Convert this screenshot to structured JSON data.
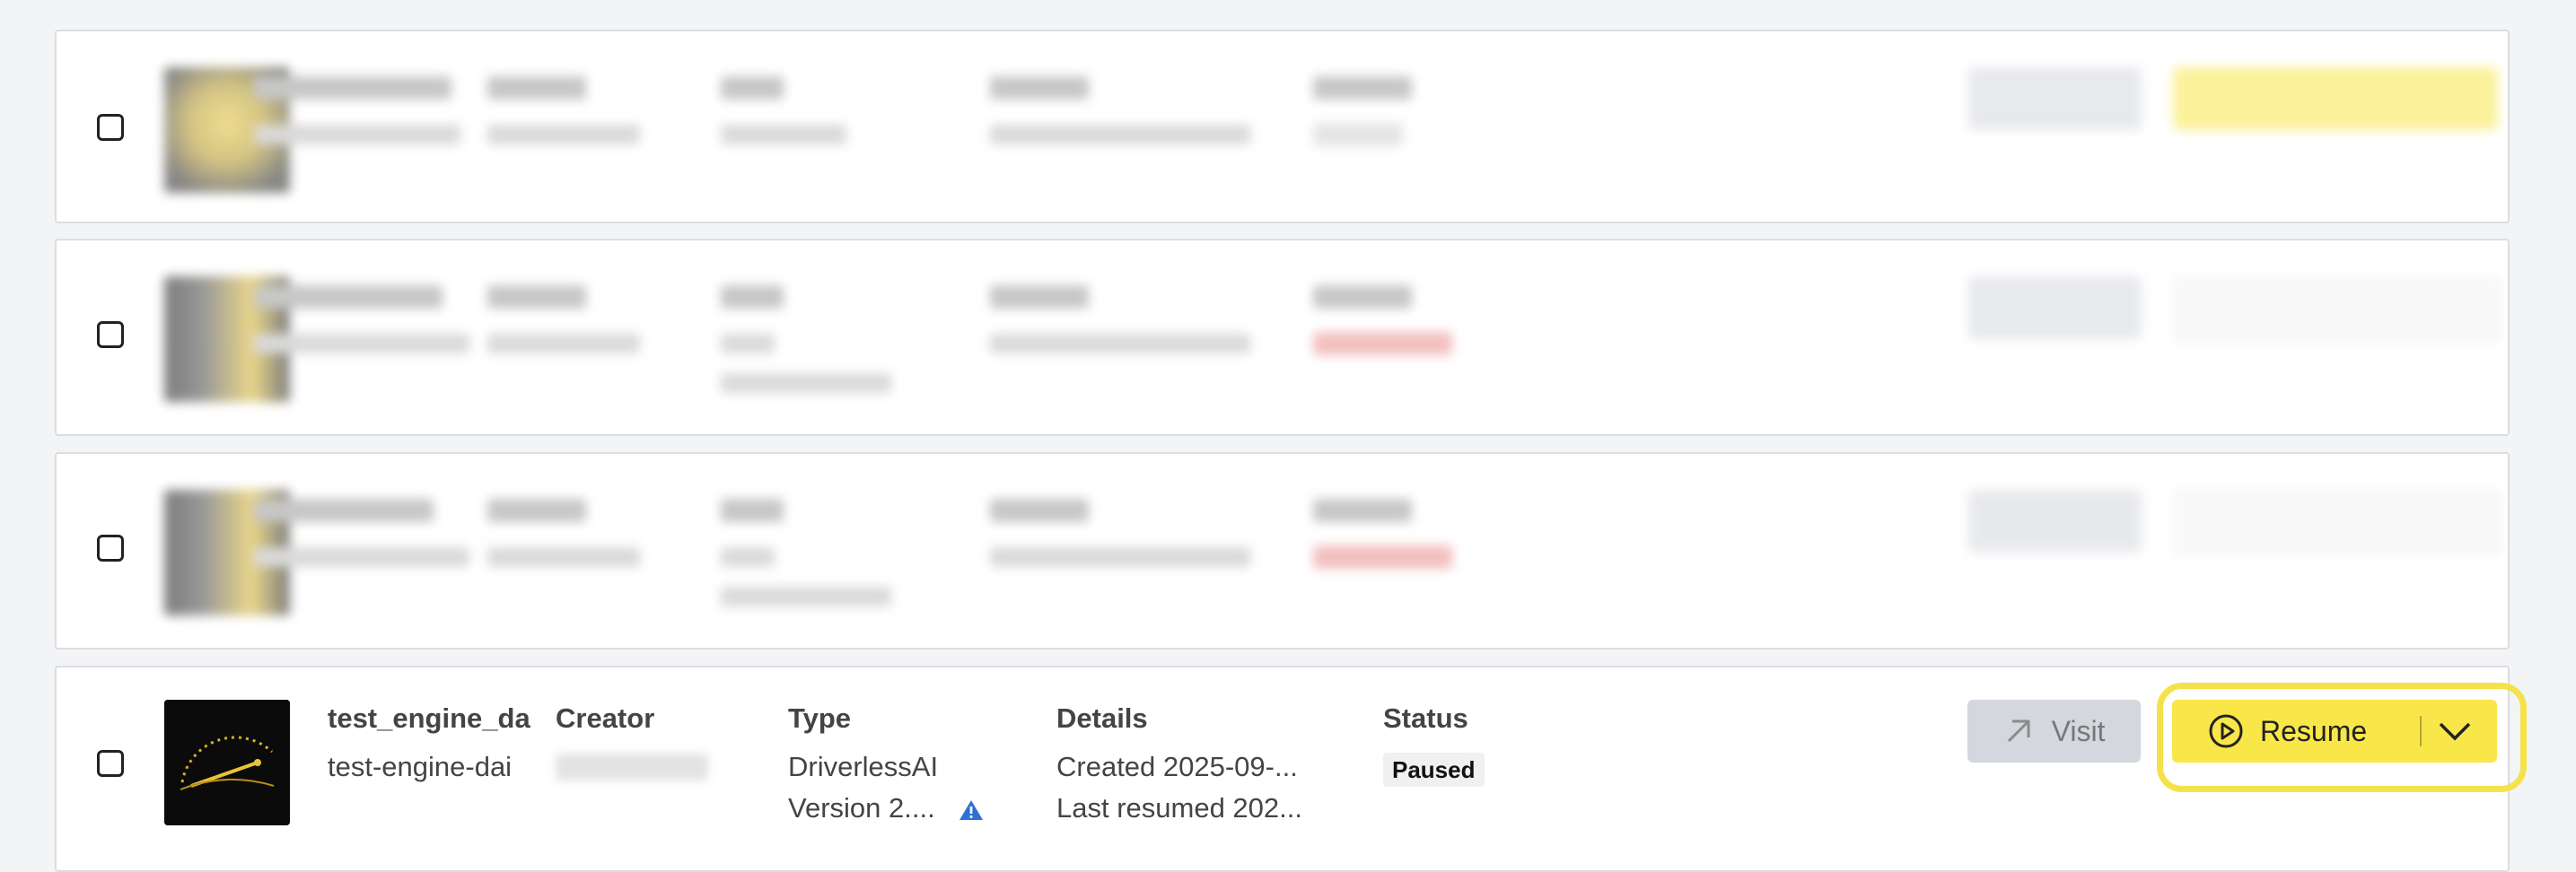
{
  "columns": {
    "creator": "Creator",
    "type": "Type",
    "details": "Details",
    "status": "Status"
  },
  "rows": [
    {
      "name": "test_engine_da",
      "slug": "test-engine-dai",
      "type_value": "DriverlessAI",
      "version": "Version 2....",
      "details_created": "Created 2025-09-...",
      "details_resumed": "Last resumed 202...",
      "status": "Paused",
      "visit_label": "Visit",
      "resume_label": "Resume",
      "warning_color": "#2f6fd6"
    }
  ],
  "colors": {
    "accent_yellow": "#f9e649",
    "highlight_ring": "#f5e24a",
    "visit_bg": "#d4d7dd",
    "error_badge": "#e98b8b"
  }
}
